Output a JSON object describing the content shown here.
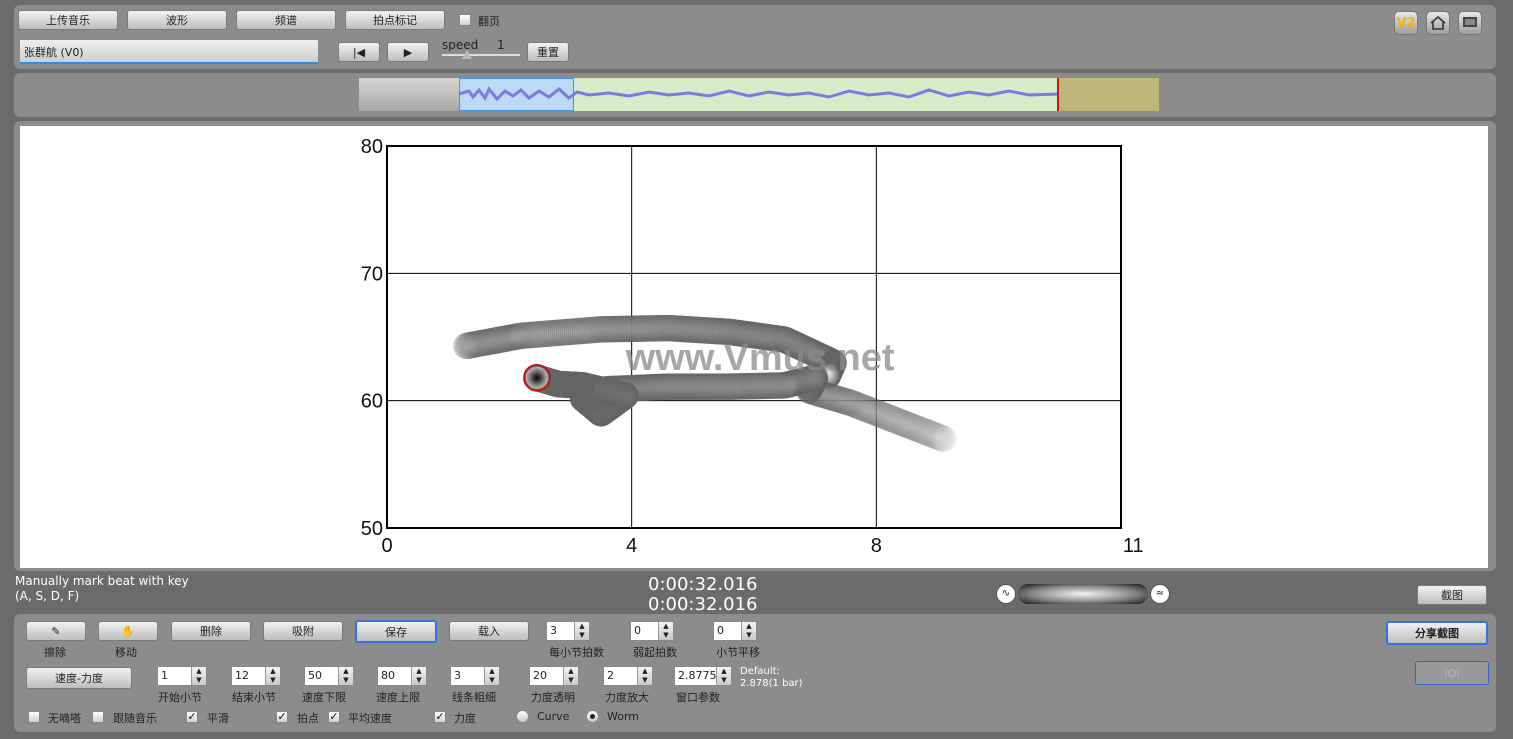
{
  "toolbar": {
    "upload": "上传音乐",
    "waveform": "波形",
    "spectrum": "频谱",
    "beat_mark": "拍点标记",
    "flip_page": "翻页",
    "track_name": "张群航 (V0)",
    "speed_label": "speed",
    "speed_value": "1",
    "reset": "重置"
  },
  "corner_icons": [
    "v2-badge-icon",
    "home-icon",
    "monitor-icon"
  ],
  "corner": {
    "v2": "V2"
  },
  "chart_data": {
    "type": "scatter",
    "style": "worm",
    "xlim": [
      0,
      11
    ],
    "ylim": [
      50,
      80
    ],
    "x_ticks": [
      "0",
      "4",
      "8",
      "11"
    ],
    "y_ticks": [
      "80",
      "70",
      "60",
      "50"
    ],
    "grid_x": [
      0,
      4,
      8,
      12
    ],
    "grid_y": [
      50,
      60,
      70,
      80
    ],
    "watermark": "www.Vmus.net",
    "trail": [
      [
        9.1,
        57.0
      ],
      [
        8.4,
        58.3
      ],
      [
        7.6,
        59.8
      ],
      [
        6.9,
        60.8
      ],
      [
        7.0,
        61.8
      ],
      [
        6.5,
        61.2
      ],
      [
        5.6,
        61.1
      ],
      [
        4.6,
        61.1
      ],
      [
        3.6,
        60.9
      ],
      [
        3.2,
        60.2
      ],
      [
        3.5,
        59.0
      ],
      [
        3.9,
        60.4
      ],
      [
        3.2,
        61.2
      ],
      [
        2.8,
        61.3
      ],
      [
        2.45,
        61.8
      ]
    ],
    "faded_trail": [
      [
        1.3,
        64.3
      ],
      [
        2.2,
        65.1
      ],
      [
        3.5,
        65.6
      ],
      [
        4.6,
        65.7
      ],
      [
        5.6,
        65.4
      ],
      [
        6.5,
        64.8
      ],
      [
        7.3,
        63.0
      ],
      [
        7.2,
        61.9
      ]
    ],
    "current_point": [
      2.45,
      61.8
    ]
  },
  "status": {
    "hint_line1": "Manually mark beat with key",
    "hint_line2": "(A, S, D, F)",
    "time1": "0:00:32.016",
    "time2": "0:00:32.016",
    "screenshot": "截图"
  },
  "bottom": {
    "erase": "擦除",
    "move": "移动",
    "delete": "删除",
    "snap": "吸附",
    "save": "保存",
    "load": "载入",
    "beats_per_bar_value": "3",
    "beats_per_bar": "每小节拍数",
    "pickup_value": "0",
    "pickup": "弱起拍数",
    "bar_shift_value": "0",
    "bar_shift": "小节平移",
    "share": "分享截图",
    "tempo_dynamics": "速度-力度",
    "start_bar_value": "1",
    "start_bar": "开始小节",
    "end_bar_value": "12",
    "end_bar": "结束小节",
    "tempo_low_value": "50",
    "tempo_low": "速度下限",
    "tempo_high_value": "80",
    "tempo_high": "速度上限",
    "line_width_value": "3",
    "line_width": "线条粗细",
    "dyn_trans_value": "20",
    "dyn_trans": "力度透明",
    "dyn_scale_value": "2",
    "dyn_scale": "力度放大",
    "window_value": "2.8775",
    "window": "窗口参数",
    "default_line1": "Default:",
    "default_line2": "2.878(1 bar)",
    "disabled_btn": "IOI",
    "mute": "无嘀嗒",
    "follow": "跟随音乐",
    "smooth": "平滑",
    "beats": "拍点",
    "avg_tempo": "平均速度",
    "dynamics": "力度",
    "curve": "Curve",
    "worm": "Worm"
  }
}
